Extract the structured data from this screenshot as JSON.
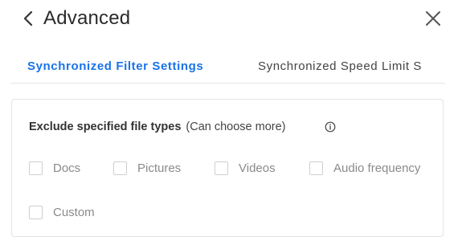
{
  "header": {
    "title": "Advanced",
    "back_icon": "chevron-left-icon",
    "close_icon": "close-icon"
  },
  "tabs": [
    {
      "label": "Synchronized Filter Settings",
      "active": true
    },
    {
      "label": "Synchronized Speed Limit S",
      "active": false
    }
  ],
  "filter": {
    "label": "Exclude specified file types",
    "hint": "(Can choose more)",
    "info_icon": "info-icon",
    "options": [
      {
        "label": "Docs",
        "checked": false
      },
      {
        "label": "Pictures",
        "checked": false
      },
      {
        "label": "Videos",
        "checked": false
      },
      {
        "label": "Audio frequency",
        "checked": false
      },
      {
        "label": "Custom",
        "checked": false
      }
    ]
  },
  "colors": {
    "accent": "#1a73e8",
    "text": "#333333",
    "muted": "#8a8a8a",
    "border": "#e3e3e3"
  }
}
